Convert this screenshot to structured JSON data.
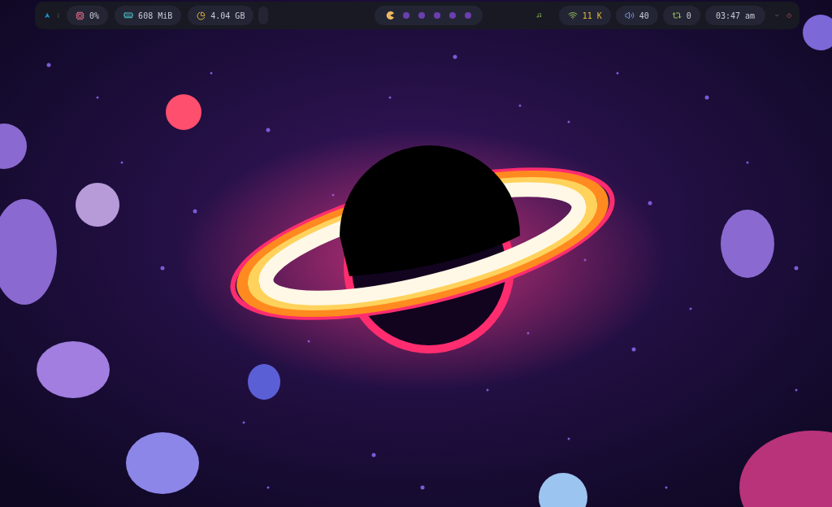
{
  "cpu": {
    "reading": "0%"
  },
  "memory": {
    "reading": "608 MiB"
  },
  "disk": {
    "reading": "4.04 GB"
  },
  "workspaces": [
    {
      "selected": true
    },
    {
      "selected": false
    },
    {
      "selected": false
    },
    {
      "selected": false
    },
    {
      "selected": false
    },
    {
      "selected": false
    }
  ],
  "network": {
    "reading": "11 K"
  },
  "volume": {
    "reading": "40"
  },
  "updates": {
    "reading": "0"
  },
  "clock": {
    "time": "03:47 am"
  }
}
